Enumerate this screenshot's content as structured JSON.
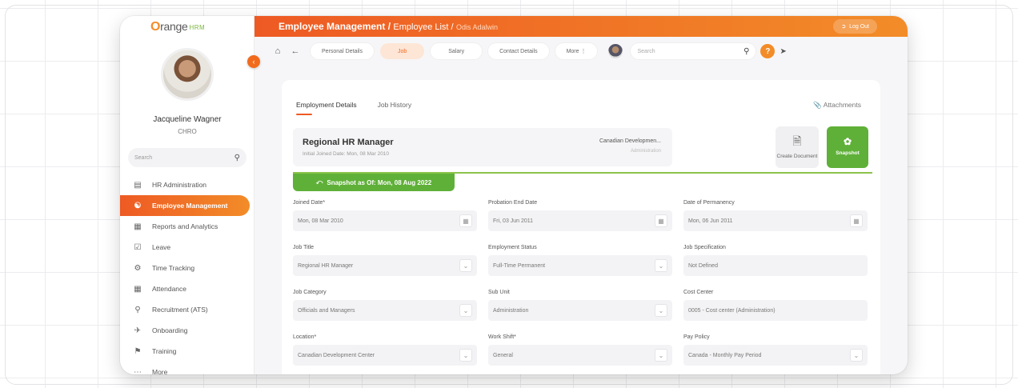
{
  "app": {
    "logo_text": "range",
    "logo_o": "O",
    "logo_sub": "HRM"
  },
  "header": {
    "breadcrumb_main": "Employee Management /",
    "breadcrumb_sub": "Employee List /",
    "breadcrumb_leaf": "Odis Adalwin",
    "logout_label": "Log Out",
    "accent": "#ee5a24"
  },
  "user": {
    "name": "Jacqueline Wagner",
    "role": "CHRO"
  },
  "sidebar": {
    "search_placeholder": "Search",
    "items": [
      {
        "label": "HR Administration",
        "icon": "admin-icon"
      },
      {
        "label": "Employee Management",
        "icon": "employee-icon",
        "active": true
      },
      {
        "label": "Reports and Analytics",
        "icon": "reports-icon"
      },
      {
        "label": "Leave",
        "icon": "leave-icon"
      },
      {
        "label": "Time Tracking",
        "icon": "time-icon"
      },
      {
        "label": "Attendance",
        "icon": "attendance-icon"
      },
      {
        "label": "Recruitment (ATS)",
        "icon": "recruitment-icon"
      },
      {
        "label": "Onboarding",
        "icon": "onboarding-icon"
      },
      {
        "label": "Training",
        "icon": "training-icon"
      },
      {
        "label": "More",
        "icon": "more-icon"
      }
    ]
  },
  "topnav": {
    "tabs": [
      "Personal Details",
      "Job",
      "Salary",
      "Contact Details",
      "More"
    ],
    "active_tab": "Job",
    "search_placeholder": "Search",
    "help_label": "?"
  },
  "content": {
    "tabs": [
      "Employment Details",
      "Job History"
    ],
    "attachments_label": "Attachments",
    "job": {
      "title": "Regional HR Manager",
      "joined": "Initial Joined Date: Mon, 08 Mar 2010",
      "org": "Canadian Developmen...",
      "org_sub": "Administration"
    },
    "create_document_label": "Create Document",
    "snapshot_label": "Snapshot",
    "snapshot_bar": "Snapshot as Of: Mon, 08 Aug 2022",
    "fields": [
      {
        "label": "Joined Date*",
        "value": "Mon, 08 Mar 2010",
        "kind": "date"
      },
      {
        "label": "Probation End Date",
        "value": "Fri, 03 Jun 2011",
        "kind": "date"
      },
      {
        "label": "Date of Permanency",
        "value": "Mon, 06 Jun 2011",
        "kind": "date"
      },
      {
        "label": "Job Title",
        "value": "Regional HR Manager",
        "kind": "select"
      },
      {
        "label": "Employment Status",
        "value": "Full-Time Permanent",
        "kind": "select"
      },
      {
        "label": "Job Specification",
        "value": "Not Defined",
        "kind": "text"
      },
      {
        "label": "Job Category",
        "value": "Officials and Managers",
        "kind": "select"
      },
      {
        "label": "Sub Unit",
        "value": "Administration",
        "kind": "select"
      },
      {
        "label": "Cost Center",
        "value": "0005 - Cost center (Administration)",
        "kind": "text"
      },
      {
        "label": "Location*",
        "value": "Canadian Development Center",
        "kind": "select"
      },
      {
        "label": "Work Shift*",
        "value": "General",
        "kind": "select"
      },
      {
        "label": "Pay Policy",
        "value": "Canada - Monthly Pay Period",
        "kind": "select"
      }
    ]
  }
}
